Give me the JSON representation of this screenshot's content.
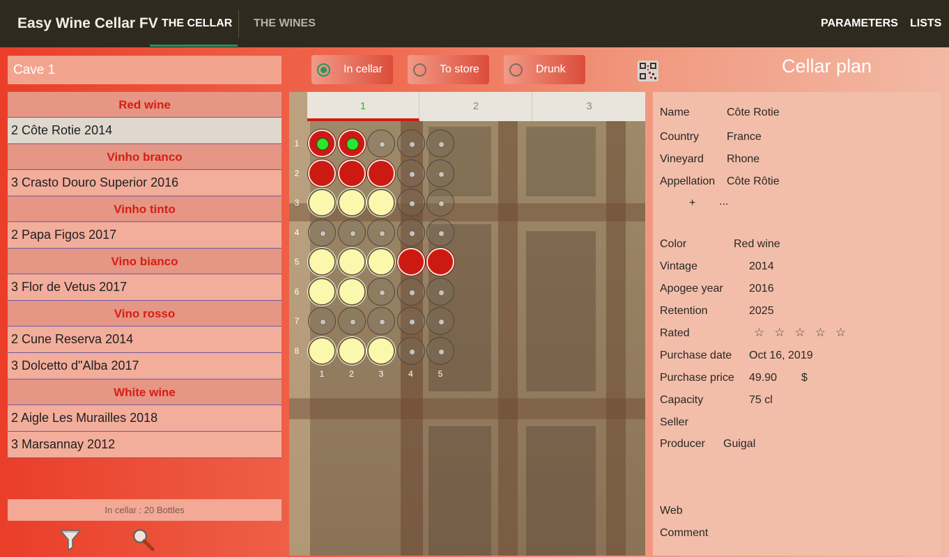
{
  "app": {
    "title": "Easy Wine Cellar FV",
    "tabs": [
      "THE CELLAR",
      "THE WINES"
    ],
    "right_menu": [
      "PARAMETERS",
      "LISTS"
    ]
  },
  "left": {
    "cave": "Cave 1",
    "groups": [
      {
        "header": "Red wine",
        "items": [
          "2 Côte Rotie 2014"
        ]
      },
      {
        "header": "Vinho branco",
        "items": [
          "3 Crasto Douro Superior 2016"
        ]
      },
      {
        "header": "Vinho tinto",
        "items": [
          "2 Papa Figos 2017"
        ]
      },
      {
        "header": "Vino bianco",
        "items": [
          "3 Flor de Vetus 2017"
        ]
      },
      {
        "header": "Vino rosso",
        "items": [
          "2 Cune Reserva 2014",
          "3 Dolcetto d\"Alba 2017"
        ]
      },
      {
        "header": "White wine",
        "items": [
          "2 Aigle Les Murailles 2018",
          "3 Marsannay 2012"
        ]
      }
    ],
    "status": "In cellar : 20 Bottles"
  },
  "filters": {
    "in_cellar": "In cellar",
    "to_store": "To store",
    "drunk": "Drunk"
  },
  "cellar_plan_title": "Cellar plan",
  "rack": {
    "tabs": [
      "1",
      "2",
      "3"
    ],
    "row_labels": [
      "1",
      "2",
      "3",
      "4",
      "5",
      "6",
      "7",
      "8"
    ],
    "col_labels": [
      "1",
      "2",
      "3",
      "4",
      "5"
    ],
    "slots": [
      [
        "green",
        "green",
        "empty",
        "empty",
        "empty"
      ],
      [
        "red",
        "red",
        "red",
        "empty",
        "empty"
      ],
      [
        "yellow",
        "yellow",
        "yellow",
        "empty",
        "empty"
      ],
      [
        "empty",
        "empty",
        "empty",
        "empty",
        "empty"
      ],
      [
        "yellow",
        "yellow",
        "yellow",
        "red",
        "red"
      ],
      [
        "yellow",
        "yellow",
        "empty",
        "empty",
        "empty"
      ],
      [
        "empty",
        "empty",
        "empty",
        "empty",
        "empty"
      ],
      [
        "yellow",
        "yellow",
        "yellow",
        "empty",
        "empty"
      ]
    ]
  },
  "detail": {
    "name_label": "Name",
    "name": "Côte Rotie",
    "country_label": "Country",
    "country": "France",
    "vineyard_label": "Vineyard",
    "vineyard": "Rhone",
    "appellation_label": "Appellation",
    "appellation": "Côte Rôtie",
    "plus": "+",
    "more": "...",
    "color_label": "Color",
    "color": "Red wine",
    "vintage_label": "Vintage",
    "vintage": "2014",
    "apogee_label": "Apogee year",
    "apogee": "2016",
    "retention_label": "Retention",
    "retention": "2025",
    "rated_label": "Rated",
    "rating": 0,
    "purchase_date_label": "Purchase date",
    "purchase_date": "Oct 16, 2019",
    "purchase_price_label": "Purchase price",
    "purchase_price": "49.90",
    "currency": "$",
    "capacity_label": "Capacity",
    "capacity": "75 cl",
    "seller_label": "Seller",
    "producer_label": "Producer",
    "producer": "Guigal",
    "web_label": "Web",
    "comment_label": "Comment"
  }
}
